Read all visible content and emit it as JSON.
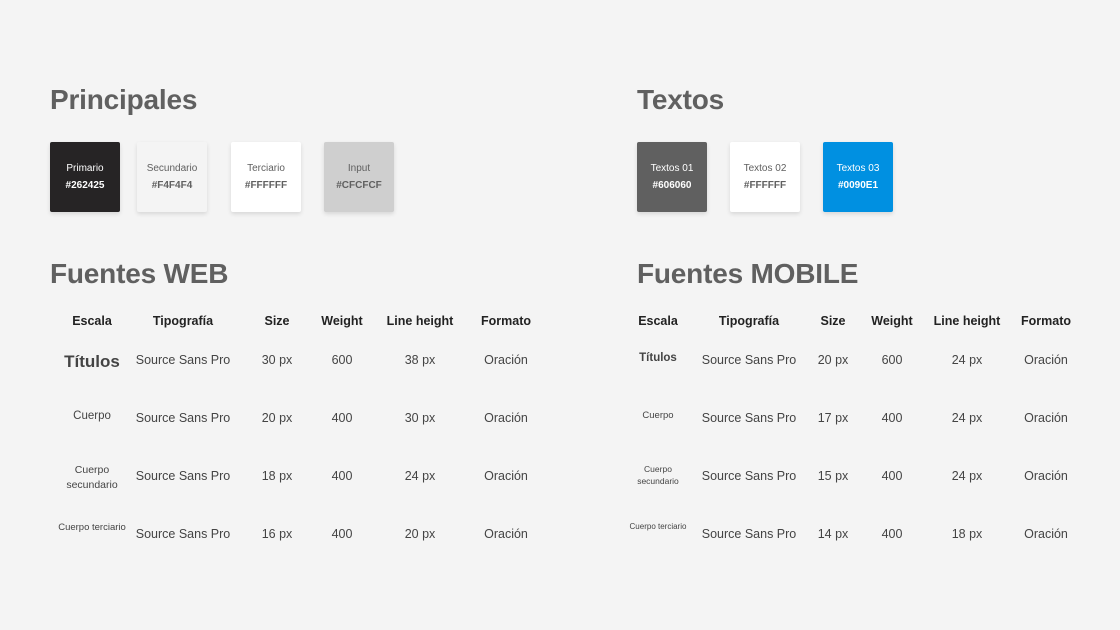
{
  "sections": {
    "principales_title": "Principales",
    "textos_title": "Textos",
    "web_title": "Fuentes WEB",
    "mobile_title": "Fuentes MOBILE"
  },
  "principales_swatches": [
    {
      "name": "Primario",
      "hex": "#262425",
      "bg": "#262425",
      "fg": "#FFFFFF"
    },
    {
      "name": "Secundario",
      "hex": "#F4F4F4",
      "bg": "#F4F4F4",
      "fg": "#606060"
    },
    {
      "name": "Terciario",
      "hex": "#FFFFFF",
      "bg": "#FFFFFF",
      "fg": "#606060"
    },
    {
      "name": "Input",
      "hex": "#CFCFCF",
      "bg": "#CFCFCF",
      "fg": "#606060"
    }
  ],
  "textos_swatches": [
    {
      "name": "Textos 01",
      "hex": "#606060",
      "bg": "#606060",
      "fg": "#FFFFFF"
    },
    {
      "name": "Textos 02",
      "hex": "#FFFFFF",
      "bg": "#FFFFFF",
      "fg": "#606060"
    },
    {
      "name": "Textos 03",
      "hex": "#0090E1",
      "bg": "#0090E1",
      "fg": "#FFFFFF"
    }
  ],
  "web_table": {
    "headers": [
      "Escala",
      "Tipografía",
      "Size",
      "Weight",
      "Line height",
      "Formato"
    ],
    "rows": [
      {
        "scale": "Títulos",
        "font": "Source Sans Pro",
        "size": "30 px",
        "weight": "600",
        "line_height": "38 px",
        "format": "Oración"
      },
      {
        "scale": "Cuerpo",
        "font": "Source Sans Pro",
        "size": "20 px",
        "weight": "400",
        "line_height": "30 px",
        "format": "Oración"
      },
      {
        "scale": "Cuerpo secundario",
        "font": "Source Sans Pro",
        "size": "18 px",
        "weight": "400",
        "line_height": "24 px",
        "format": "Oración"
      },
      {
        "scale": "Cuerpo terciario",
        "font": "Source Sans Pro",
        "size": "16 px",
        "weight": "400",
        "line_height": "20 px",
        "format": "Oración"
      }
    ]
  },
  "mobile_table": {
    "headers": [
      "Escala",
      "Tipografía",
      "Size",
      "Weight",
      "Line height",
      "Formato"
    ],
    "rows": [
      {
        "scale": "Títulos",
        "font": "Source Sans Pro",
        "size": "20 px",
        "weight": "600",
        "line_height": "24 px",
        "format": "Oración"
      },
      {
        "scale": "Cuerpo",
        "font": "Source Sans Pro",
        "size": "17 px",
        "weight": "400",
        "line_height": "24 px",
        "format": "Oración"
      },
      {
        "scale": "Cuerpo secundario",
        "font": "Source Sans Pro",
        "size": "15 px",
        "weight": "400",
        "line_height": "24 px",
        "format": "Oración"
      },
      {
        "scale": "Cuerpo terciario",
        "font": "Source Sans Pro",
        "size": "14 px",
        "weight": "400",
        "line_height": "18 px",
        "format": "Oración"
      }
    ]
  }
}
